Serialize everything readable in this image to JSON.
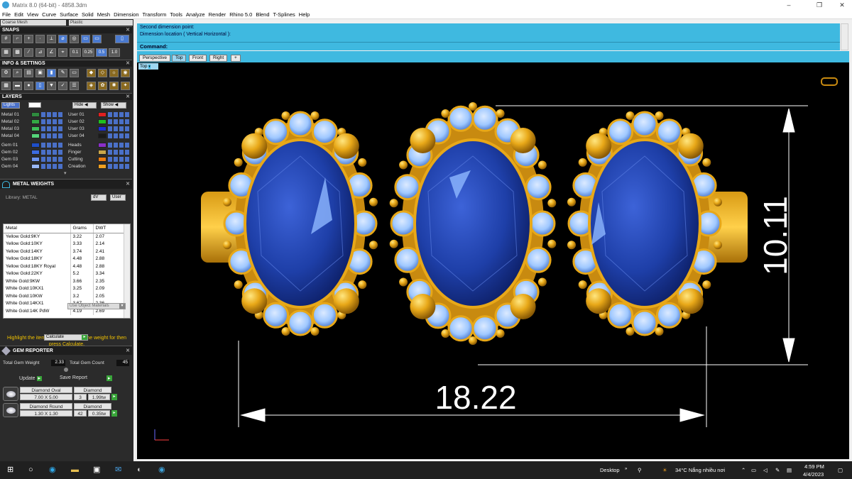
{
  "window": {
    "title": "Matrix 8.0 (64-bit) - 4858.3dm",
    "minimize": "–",
    "maximize": "❐",
    "close": "✕"
  },
  "menu": [
    "File",
    "Edit",
    "View",
    "Curve",
    "Surface",
    "Solid",
    "Mesh",
    "Dimension",
    "Transform",
    "Tools",
    "Analyze",
    "Render",
    "Rhino 5.0",
    "Blend",
    "T-Splines",
    "Help"
  ],
  "top_dropdowns": {
    "mesh": "Coarse Mesh",
    "material": "Plastic"
  },
  "snaps": {
    "title": "SNAPS",
    "values": [
      "0.1",
      "0.25",
      "0.5",
      "1.0"
    ]
  },
  "info": {
    "title": "INFO & SETTINGS"
  },
  "layers": {
    "title": "LAYERS",
    "lights": "Lights",
    "hide": "Hide",
    "show": "Show",
    "left": [
      {
        "name": "Metal 01",
        "color": "#2e8b3e"
      },
      {
        "name": "Metal 02",
        "color": "#33a844"
      },
      {
        "name": "Metal 03",
        "color": "#3dbf58"
      },
      {
        "name": "Metal 04",
        "color": "#55d47a"
      },
      {
        "name": "Gem 01",
        "color": "#1e4ec8"
      },
      {
        "name": "Gem 02",
        "color": "#3c6be0"
      },
      {
        "name": "Gem 03",
        "color": "#6d94ee"
      },
      {
        "name": "Gem 04",
        "color": "#9ab8f5"
      }
    ],
    "right": [
      {
        "name": "User 01",
        "color": "#e02020"
      },
      {
        "name": "User 02",
        "color": "#20c020"
      },
      {
        "name": "User 03",
        "color": "#1f2ed8"
      },
      {
        "name": "User 04",
        "color": "#1a1a1a"
      },
      {
        "name": "Heads",
        "color": "#8a2fc8"
      },
      {
        "name": "Finger",
        "color": "#c9a64a"
      },
      {
        "name": "Cutting",
        "color": "#e87a10"
      },
      {
        "name": "Creation",
        "color": "#f0a020"
      }
    ]
  },
  "metal_weights": {
    "title": "METAL WEIGHTS",
    "library": "Library: METAL",
    "dv": "dV",
    "user": "User",
    "headers": [
      "Metal",
      "Grams",
      "DWT"
    ],
    "rows": [
      [
        "Yellow Gold:9KY",
        "3.22",
        "2.07"
      ],
      [
        "Yellow Gold:10KY",
        "3.33",
        "2.14"
      ],
      [
        "Yellow Gold:14KY",
        "3.74",
        "2.41"
      ],
      [
        "Yellow Gold:18KY",
        "4.48",
        "2.88"
      ],
      [
        "Yellow Gold:18KY Royal",
        "4.48",
        "2.88"
      ],
      [
        "Yellow Gold:22KY",
        "5.2",
        "3.34"
      ],
      [
        "White Gold:9KW",
        "3.66",
        "2.35"
      ],
      [
        "White Gold:10KX1",
        "3.25",
        "2.09"
      ],
      [
        "White Gold:10KW",
        "3.2",
        "2.05"
      ],
      [
        "White Gold:14KX1",
        "3.67",
        "2.36"
      ],
      [
        "White Gold:14K PdW",
        "4.19",
        "2.69"
      ]
    ],
    "use_materials": "Use Object Materials",
    "hint": "Highlight the items you want to find the weight for then press Calculate.",
    "calculate": "Calculate"
  },
  "gem_reporter": {
    "title": "GEM REPORTER",
    "total_weight_label": "Total Gem Weight",
    "total_weight": "2.33",
    "total_count_label": "Total Gem Count",
    "total_count": "45",
    "update": "Update",
    "save": "Save Report",
    "gems": [
      {
        "name": "Diamond Oval",
        "size": "7.00 X 5.00",
        "type": "Diamond",
        "count": "3",
        "weight": "1.99tw"
      },
      {
        "name": "Diamond Round",
        "size": "1.30 X 1.30",
        "type": "Diamond",
        "count": "42",
        "weight": "0.35tw"
      }
    ]
  },
  "command": {
    "line1": "Second dimension point:",
    "line2": "Dimension location ( Vertical  Horizontal ):",
    "prompt": "Command:"
  },
  "viewport_tabs": [
    "Perspective",
    "Top",
    "Front",
    "Right",
    "+"
  ],
  "viewport_label": "Top",
  "dimensions": {
    "width": "18.22",
    "height": "10.11"
  },
  "taskbar": {
    "desktop": "Desktop",
    "weather": "34°C  Nắng nhiều nơi",
    "time": "4:59 PM",
    "date": "4/4/2023"
  },
  "colors": {
    "accent": "#3fb9e0",
    "gold": "#e8a818",
    "sapphire": "#1e3fa8",
    "diamond": "#9fc8ff"
  }
}
